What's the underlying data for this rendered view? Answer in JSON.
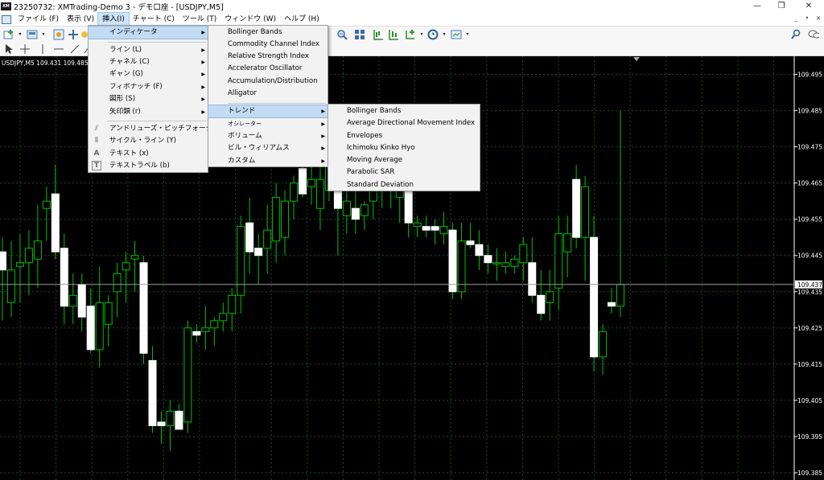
{
  "window": {
    "app_icon_text": "XM",
    "title": "23250732: XMTrading-Demo 3 - デモ口座 - [USDJPY,M5]",
    "buttons": [
      "—",
      "❐",
      "✕"
    ]
  },
  "menubar": {
    "items": [
      "ファイル (F)",
      "表示 (V)",
      "挿入(I)",
      "チャート (C)",
      "ツール (T)",
      "ウィンドウ (W)",
      "ヘルプ (H)"
    ],
    "active_index": 2,
    "mdi_controls": [
      "_",
      "•",
      "×"
    ]
  },
  "insert_menu": {
    "items": [
      {
        "label": "インディケータ",
        "submenu": true,
        "highlighted": true
      },
      {
        "label": "ライン (L)",
        "submenu": true
      },
      {
        "label": "チャネル (C)",
        "submenu": true
      },
      {
        "label": "ギャン (G)",
        "submenu": true
      },
      {
        "label": "フィボナッチ (F)",
        "submenu": true
      },
      {
        "label": "図形 (S)",
        "submenu": true
      },
      {
        "label": "矢印類 (r)",
        "submenu": true
      },
      {
        "label": "アンドリューズ・ピッチフォーク (A)",
        "icon": "pitchfork-icon"
      },
      {
        "label": "サイクル・ライン (Y)",
        "icon": "cycle-lines-icon"
      },
      {
        "label": "テキスト (x)",
        "icon": "text-icon"
      },
      {
        "label": "テキストラベル (b)",
        "icon": "text-label-icon"
      }
    ]
  },
  "indicators_menu": {
    "items": [
      {
        "label": "Bollinger Bands"
      },
      {
        "label": "Commodity Channel Index"
      },
      {
        "label": "Relative Strength Index"
      },
      {
        "label": "Accelerator Oscillator"
      },
      {
        "label": "Accumulation/Distribution"
      },
      {
        "label": "Alligator"
      },
      {
        "label": "トレンド",
        "submenu": true,
        "highlighted": true
      },
      {
        "label": "オシレーター",
        "submenu": true
      },
      {
        "label": "ボリューム",
        "submenu": true
      },
      {
        "label": "ビル・ウィリアムス",
        "submenu": true
      },
      {
        "label": "カスタム",
        "submenu": true
      }
    ]
  },
  "trend_menu": {
    "items": [
      "Bollinger Bands",
      "Average Directional Movement Index",
      "Envelopes",
      "Ichimoku Kinko Hyo",
      "Moving Average",
      "Parabolic SAR",
      "Standard Deviation"
    ]
  },
  "chart": {
    "symbol_label": "USDJPY,M5  109.431 109.485 109.4",
    "current_price_label": "109.437",
    "current_price": 109.437,
    "colors": {
      "background": "#000000",
      "bull_body": "#ffffff",
      "wick": "#00c000",
      "grid": "#1e4d1e",
      "price_line": "#9c9c9c"
    },
    "y_axis_ticks": [
      "109.495",
      "109.485",
      "109.475",
      "109.465",
      "109.455",
      "109.445",
      "109.435",
      "109.425",
      "109.415",
      "109.405",
      "109.395",
      "109.385"
    ]
  },
  "chart_data": {
    "type": "candlestick",
    "symbol": "USDJPY",
    "timeframe": "M5",
    "ylim": [
      109.383,
      109.5
    ],
    "grid": true,
    "candles": [
      {
        "o": 109.446,
        "h": 109.45,
        "l": 109.427,
        "c": 109.441,
        "bull": true
      },
      {
        "o": 109.432,
        "h": 109.449,
        "l": 109.428,
        "c": 109.441,
        "bull": false
      },
      {
        "o": 109.442,
        "h": 109.451,
        "l": 109.432,
        "c": 109.443,
        "bull": false
      },
      {
        "o": 109.447,
        "h": 109.452,
        "l": 109.434,
        "c": 109.443,
        "bull": false
      },
      {
        "o": 109.444,
        "h": 109.459,
        "l": 109.436,
        "c": 109.449,
        "bull": false
      },
      {
        "o": 109.458,
        "h": 109.464,
        "l": 109.449,
        "c": 109.46,
        "bull": false
      },
      {
        "o": 109.462,
        "h": 109.47,
        "l": 109.444,
        "c": 109.446,
        "bull": true
      },
      {
        "o": 109.447,
        "h": 109.451,
        "l": 109.426,
        "c": 109.431,
        "bull": true
      },
      {
        "o": 109.434,
        "h": 109.44,
        "l": 109.426,
        "c": 109.431,
        "bull": false
      },
      {
        "o": 109.437,
        "h": 109.44,
        "l": 109.424,
        "c": 109.428,
        "bull": true
      },
      {
        "o": 109.431,
        "h": 109.436,
        "l": 109.418,
        "c": 109.419,
        "bull": true
      },
      {
        "o": 109.432,
        "h": 109.442,
        "l": 109.414,
        "c": 109.419,
        "bull": false
      },
      {
        "o": 109.426,
        "h": 109.434,
        "l": 109.42,
        "c": 109.432,
        "bull": false
      },
      {
        "o": 109.44,
        "h": 109.443,
        "l": 109.428,
        "c": 109.435,
        "bull": false
      },
      {
        "o": 109.441,
        "h": 109.446,
        "l": 109.432,
        "c": 109.443,
        "bull": false
      },
      {
        "o": 109.444,
        "h": 109.449,
        "l": 109.435,
        "c": 109.445,
        "bull": false
      },
      {
        "o": 109.443,
        "h": 109.445,
        "l": 109.415,
        "c": 109.418,
        "bull": true
      },
      {
        "o": 109.416,
        "h": 109.42,
        "l": 109.396,
        "c": 109.398,
        "bull": true
      },
      {
        "o": 109.399,
        "h": 109.402,
        "l": 109.393,
        "c": 109.398,
        "bull": true
      },
      {
        "o": 109.398,
        "h": 109.405,
        "l": 109.391,
        "c": 109.402,
        "bull": false
      },
      {
        "o": 109.402,
        "h": 109.404,
        "l": 109.397,
        "c": 109.397,
        "bull": true
      },
      {
        "o": 109.399,
        "h": 109.427,
        "l": 109.396,
        "c": 109.425,
        "bull": false
      },
      {
        "o": 109.423,
        "h": 109.426,
        "l": 109.421,
        "c": 109.424,
        "bull": true
      },
      {
        "o": 109.424,
        "h": 109.431,
        "l": 109.419,
        "c": 109.425,
        "bull": false
      },
      {
        "o": 109.425,
        "h": 109.428,
        "l": 109.42,
        "c": 109.427,
        "bull": false
      },
      {
        "o": 109.427,
        "h": 109.432,
        "l": 109.424,
        "c": 109.429,
        "bull": false
      },
      {
        "o": 109.429,
        "h": 109.436,
        "l": 109.424,
        "c": 109.434,
        "bull": false
      },
      {
        "o": 109.434,
        "h": 109.456,
        "l": 109.429,
        "c": 109.453,
        "bull": false
      },
      {
        "o": 109.454,
        "h": 109.461,
        "l": 109.44,
        "c": 109.446,
        "bull": true
      },
      {
        "o": 109.445,
        "h": 109.451,
        "l": 109.437,
        "c": 109.447,
        "bull": true
      },
      {
        "o": 109.447,
        "h": 109.459,
        "l": 109.44,
        "c": 109.452,
        "bull": false
      },
      {
        "o": 109.449,
        "h": 109.465,
        "l": 109.443,
        "c": 109.461,
        "bull": false
      },
      {
        "o": 109.45,
        "h": 109.463,
        "l": 109.445,
        "c": 109.46,
        "bull": false
      },
      {
        "o": 109.465,
        "h": 109.467,
        "l": 109.455,
        "c": 109.46,
        "bull": false
      },
      {
        "o": 109.469,
        "h": 109.471,
        "l": 109.461,
        "c": 109.462,
        "bull": true
      },
      {
        "o": 109.466,
        "h": 109.47,
        "l": 109.459,
        "c": 109.464,
        "bull": false
      },
      {
        "o": 109.458,
        "h": 109.474,
        "l": 109.452,
        "c": 109.466,
        "bull": false
      },
      {
        "o": 109.47,
        "h": 109.474,
        "l": 109.46,
        "c": 109.463,
        "bull": false
      },
      {
        "o": 109.458,
        "h": 109.473,
        "l": 109.445,
        "c": 109.466,
        "bull": true
      },
      {
        "o": 109.46,
        "h": 109.467,
        "l": 109.451,
        "c": 109.456,
        "bull": false
      },
      {
        "o": 109.458,
        "h": 109.463,
        "l": 109.451,
        "c": 109.455,
        "bull": true
      },
      {
        "o": 109.456,
        "h": 109.46,
        "l": 109.452,
        "c": 109.459,
        "bull": false
      },
      {
        "o": 109.46,
        "h": 109.47,
        "l": 109.455,
        "c": 109.467,
        "bull": false
      },
      {
        "o": 109.466,
        "h": 109.47,
        "l": 109.458,
        "c": 109.463,
        "bull": false
      },
      {
        "o": 109.466,
        "h": 109.47,
        "l": 109.458,
        "c": 109.467,
        "bull": false
      },
      {
        "o": 109.464,
        "h": 109.47,
        "l": 109.454,
        "c": 109.461,
        "bull": false
      },
      {
        "o": 109.464,
        "h": 109.467,
        "l": 109.45,
        "c": 109.454,
        "bull": true
      },
      {
        "o": 109.453,
        "h": 109.456,
        "l": 109.45,
        "c": 109.454,
        "bull": false
      },
      {
        "o": 109.452,
        "h": 109.456,
        "l": 109.45,
        "c": 109.453,
        "bull": true
      },
      {
        "o": 109.453,
        "h": 109.455,
        "l": 109.448,
        "c": 109.452,
        "bull": true
      },
      {
        "o": 109.453,
        "h": 109.457,
        "l": 109.448,
        "c": 109.451,
        "bull": false
      },
      {
        "o": 109.452,
        "h": 109.454,
        "l": 109.433,
        "c": 109.435,
        "bull": true
      },
      {
        "o": 109.449,
        "h": 109.454,
        "l": 109.433,
        "c": 109.435,
        "bull": false
      },
      {
        "o": 109.449,
        "h": 109.454,
        "l": 109.447,
        "c": 109.448,
        "bull": true
      },
      {
        "o": 109.448,
        "h": 109.452,
        "l": 109.441,
        "c": 109.445,
        "bull": true
      },
      {
        "o": 109.445,
        "h": 109.448,
        "l": 109.44,
        "c": 109.443,
        "bull": true
      },
      {
        "o": 109.443,
        "h": 109.447,
        "l": 109.438,
        "c": 109.443,
        "bull": false
      },
      {
        "o": 109.442,
        "h": 109.446,
        "l": 109.44,
        "c": 109.443,
        "bull": false
      },
      {
        "o": 109.442,
        "h": 109.445,
        "l": 109.44,
        "c": 109.444,
        "bull": false
      },
      {
        "o": 109.448,
        "h": 109.45,
        "l": 109.438,
        "c": 109.443,
        "bull": false
      },
      {
        "o": 109.443,
        "h": 109.45,
        "l": 109.432,
        "c": 109.434,
        "bull": true
      },
      {
        "o": 109.434,
        "h": 109.441,
        "l": 109.427,
        "c": 109.429,
        "bull": true
      },
      {
        "o": 109.435,
        "h": 109.441,
        "l": 109.427,
        "c": 109.432,
        "bull": false
      },
      {
        "o": 109.436,
        "h": 109.456,
        "l": 109.43,
        "c": 109.451,
        "bull": false
      },
      {
        "o": 109.451,
        "h": 109.456,
        "l": 109.439,
        "c": 109.446,
        "bull": false
      },
      {
        "o": 109.466,
        "h": 109.47,
        "l": 109.447,
        "c": 109.45,
        "bull": true
      },
      {
        "o": 109.464,
        "h": 109.467,
        "l": 109.438,
        "c": 109.45,
        "bull": false
      },
      {
        "o": 109.45,
        "h": 109.456,
        "l": 109.413,
        "c": 109.417,
        "bull": true
      },
      {
        "o": 109.417,
        "h": 109.426,
        "l": 109.412,
        "c": 109.424,
        "bull": false
      },
      {
        "o": 109.432,
        "h": 109.436,
        "l": 109.429,
        "c": 109.431,
        "bull": true
      },
      {
        "o": 109.431,
        "h": 109.485,
        "l": 109.428,
        "c": 109.437,
        "bull": false
      }
    ]
  }
}
